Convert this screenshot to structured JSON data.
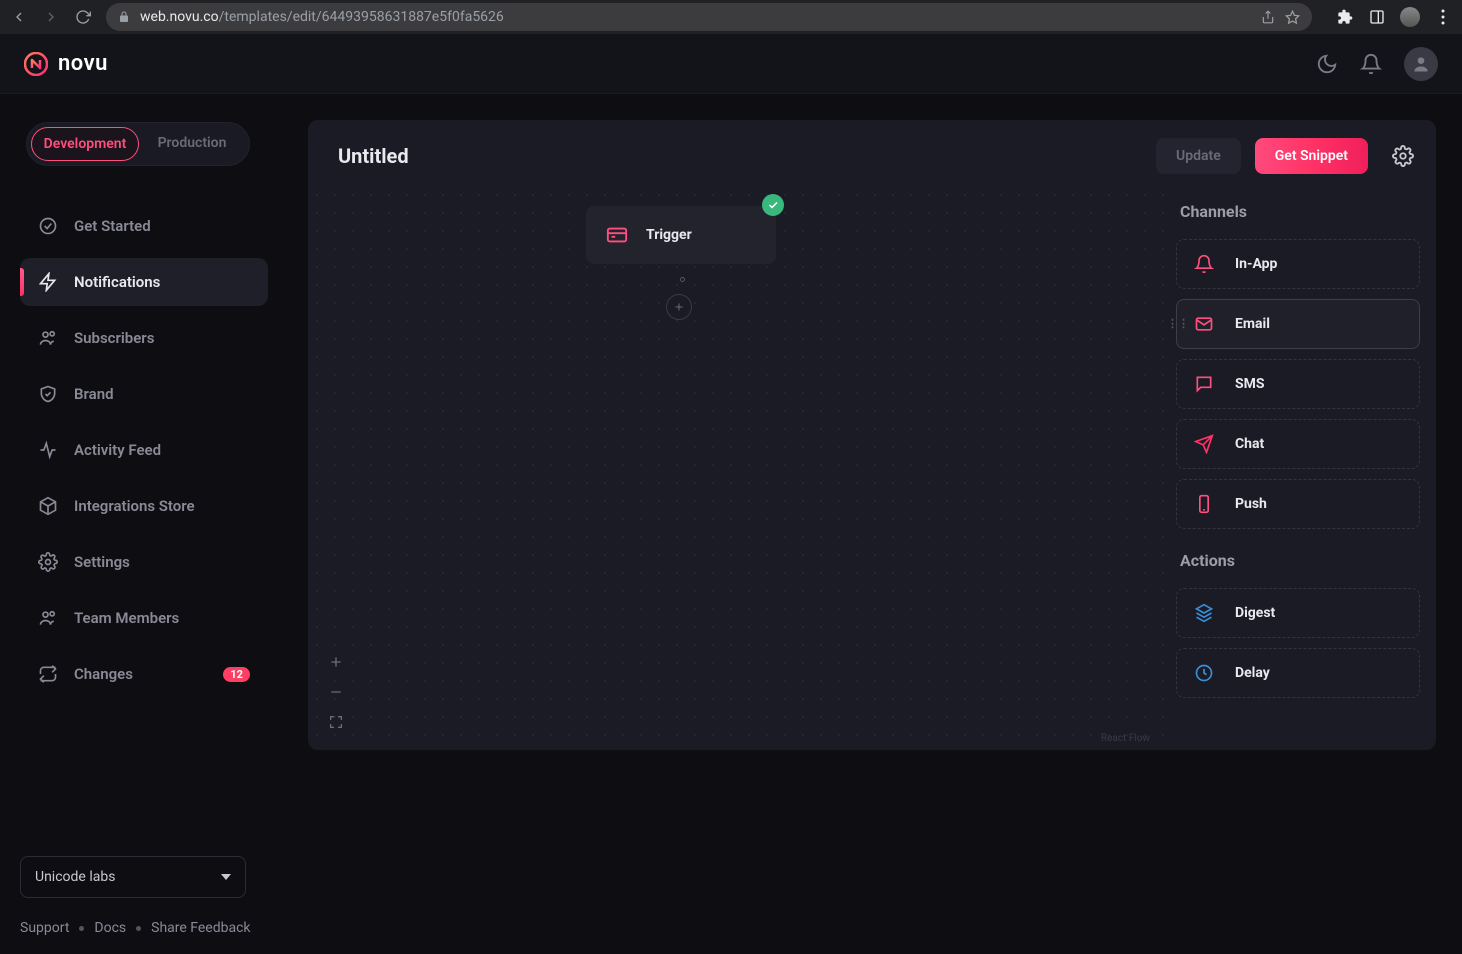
{
  "browser": {
    "url_host": "web.novu.co",
    "url_path": "/templates/edit/64493958631887e5f0fa5626"
  },
  "header": {
    "brand": "novu"
  },
  "sidebar": {
    "env": {
      "dev": "Development",
      "prod": "Production"
    },
    "items": [
      {
        "label": "Get Started"
      },
      {
        "label": "Notifications"
      },
      {
        "label": "Subscribers"
      },
      {
        "label": "Brand"
      },
      {
        "label": "Activity Feed"
      },
      {
        "label": "Integrations Store"
      },
      {
        "label": "Settings"
      },
      {
        "label": "Team Members"
      },
      {
        "label": "Changes",
        "badge": "12"
      }
    ],
    "org": "Unicode labs",
    "bottom": {
      "support": "Support",
      "docs": "Docs",
      "feedback": "Share Feedback"
    }
  },
  "main": {
    "title": "Untitled",
    "update": "Update",
    "snippet": "Get Snippet",
    "trigger": "Trigger",
    "react_flow": "React Flow"
  },
  "channels": {
    "title": "Channels",
    "items": [
      {
        "label": "In-App"
      },
      {
        "label": "Email"
      },
      {
        "label": "SMS"
      },
      {
        "label": "Chat"
      },
      {
        "label": "Push"
      }
    ],
    "actions_title": "Actions",
    "actions": [
      {
        "label": "Digest"
      },
      {
        "label": "Delay"
      }
    ]
  }
}
